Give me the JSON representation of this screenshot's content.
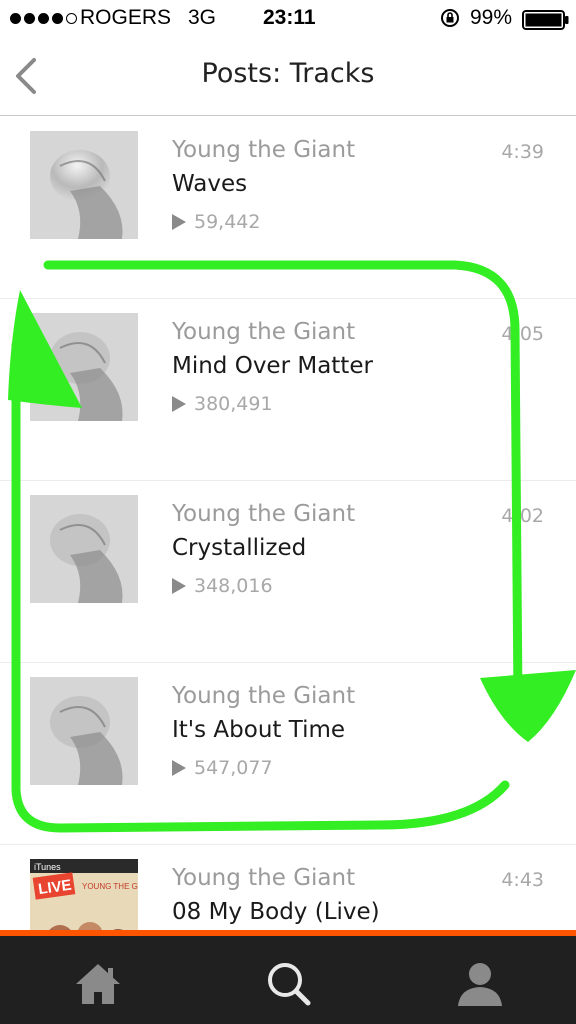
{
  "status_bar": {
    "carrier": "ROGERS",
    "network": "3G",
    "time": "23:11",
    "battery": "99%",
    "signal_bars": 4
  },
  "nav": {
    "title": "Posts: Tracks",
    "back_icon": "chevron-left-icon"
  },
  "tracks": [
    {
      "artist": "Young the Giant",
      "title": "Waves",
      "plays": "59,442",
      "duration": "4:39",
      "art": "album-cover"
    },
    {
      "artist": "Young the Giant",
      "title": "Mind Over Matter",
      "plays": "380,491",
      "duration": "4:05",
      "art": "album-cover"
    },
    {
      "artist": "Young the Giant",
      "title": "Crystallized",
      "plays": "348,016",
      "duration": "4:02",
      "art": "album-cover"
    },
    {
      "artist": "Young the Giant",
      "title": "It's About Time",
      "plays": "547,077",
      "duration": "",
      "art": "album-cover"
    },
    {
      "artist": "Young the Giant",
      "title": "08 My Body (Live)",
      "plays": "",
      "duration": "4:43",
      "art": "live-cover",
      "art_labels": {
        "badge": "LIVE",
        "brand": "iTunes",
        "band": "YOUNG THE GIANT"
      }
    }
  ],
  "tab_bar": {
    "items": [
      {
        "name": "home",
        "icon": "home-icon"
      },
      {
        "name": "search",
        "icon": "search-icon"
      },
      {
        "name": "profile",
        "icon": "profile-icon"
      }
    ]
  },
  "colors": {
    "accent": "#ff5500",
    "annotation": "#33ee22",
    "tab_bar_bg": "#202020",
    "tab_icon": "#8a8a8a"
  }
}
